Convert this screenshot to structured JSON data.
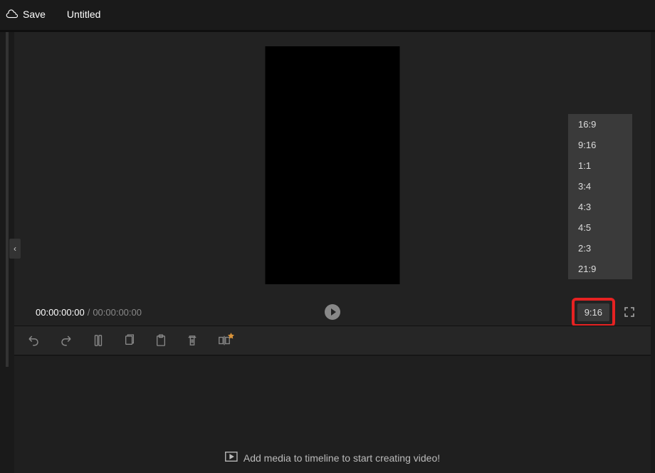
{
  "header": {
    "save_label": "Save",
    "project_title": "Untitled"
  },
  "playbar": {
    "current_time": "00:00:00:00",
    "total_time": "00:00:00:00",
    "separator": "/"
  },
  "aspect": {
    "selected": "9:16",
    "options": [
      "16:9",
      "9:16",
      "1:1",
      "3:4",
      "4:3",
      "4:5",
      "2:3",
      "21:9"
    ]
  },
  "timeline": {
    "hint": "Add media to timeline to start creating video!"
  },
  "icons": {
    "cloud": "cloud",
    "play": "play",
    "fullscreen": "fullscreen",
    "undo": "undo",
    "redo": "redo",
    "split": "split",
    "copy": "copy",
    "paste": "paste",
    "delete": "delete",
    "flip": "flip",
    "add_media": "add-media",
    "collapse": "‹"
  }
}
